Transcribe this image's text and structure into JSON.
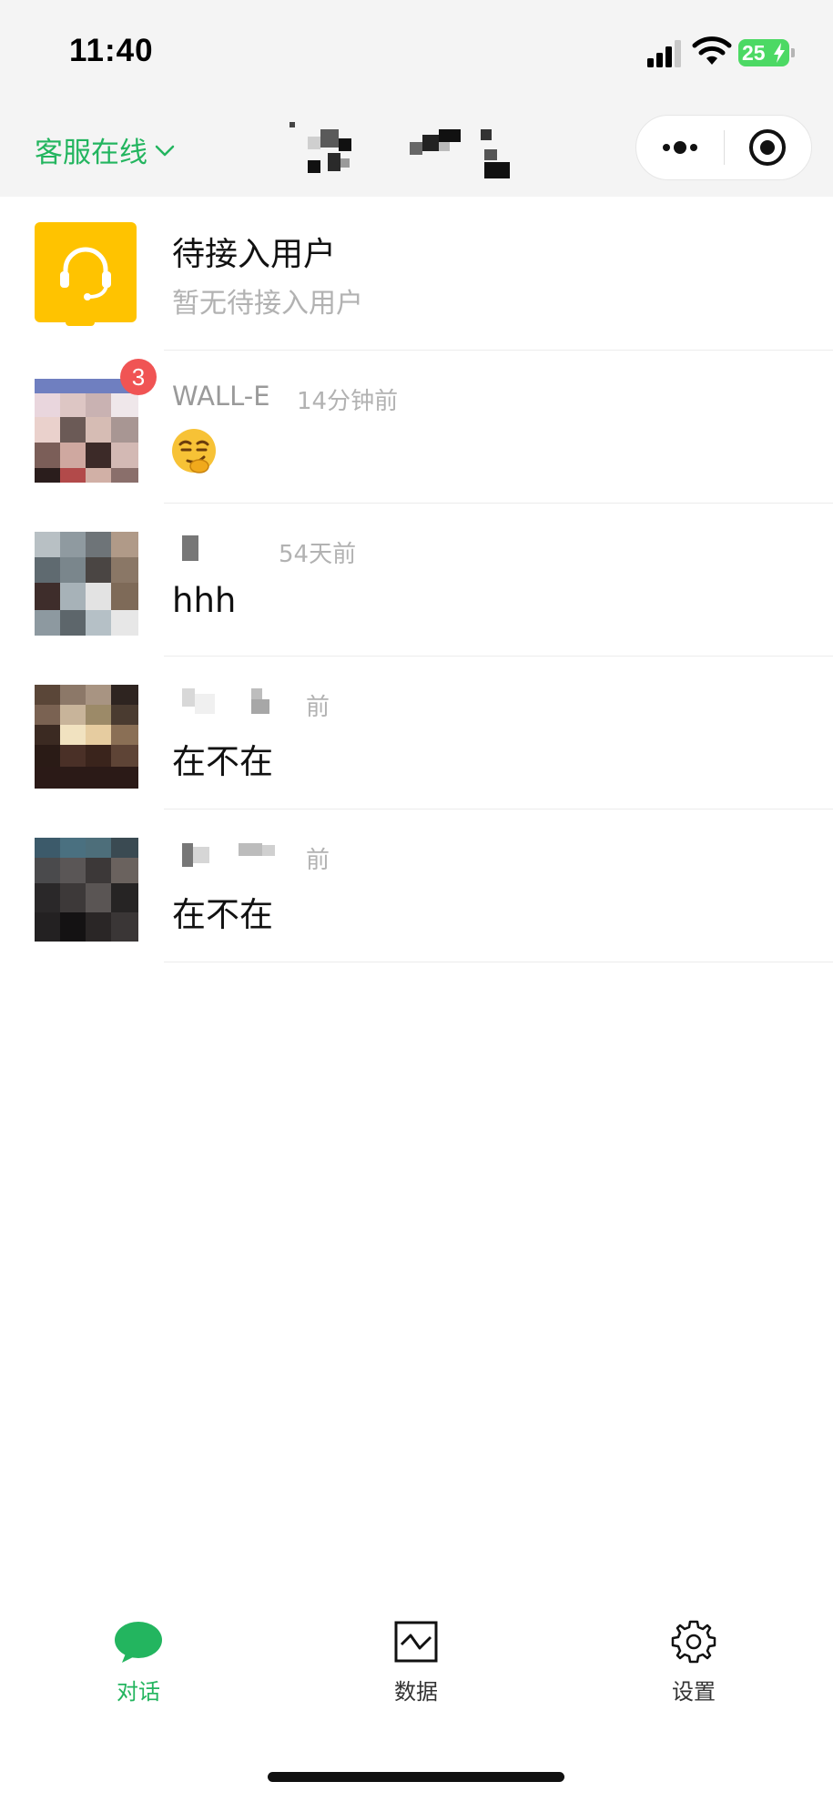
{
  "status_bar": {
    "time": "11:40",
    "battery": "25"
  },
  "nav": {
    "status_label": "客服在线",
    "title": "",
    "more_icon": "more-dots-icon",
    "close_icon": "target-circle-icon"
  },
  "pending": {
    "title": "待接入用户",
    "subtitle": "暂无待接入用户",
    "icon": "headset-icon",
    "icon_color": "#ffc300"
  },
  "conversations": [
    {
      "name": "WALL-E",
      "time": "14分钟前",
      "message": "",
      "emoji": "smirk-face",
      "unread": "3"
    },
    {
      "name": "",
      "time": "54天前",
      "message": "hhh",
      "unread": ""
    },
    {
      "name": "",
      "time": "前",
      "message": "在不在",
      "unread": ""
    },
    {
      "name": "",
      "time": "前",
      "message": "在不在",
      "unread": ""
    }
  ],
  "tabs": [
    {
      "label": "对话",
      "icon": "chat-bubble-icon",
      "active": true
    },
    {
      "label": "数据",
      "icon": "chart-icon",
      "active": false
    },
    {
      "label": "设置",
      "icon": "gear-icon",
      "active": false
    }
  ],
  "colors": {
    "accent": "#23b55f",
    "badge": "#f05454",
    "muted_text": "#b2b2b2"
  }
}
